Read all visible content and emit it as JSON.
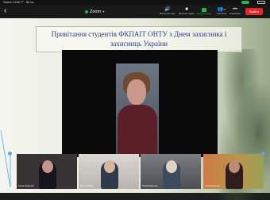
{
  "status_bar": {
    "left": "Search 13:56 77 · 86 ms"
  },
  "toolbar": {
    "back_glyph": "‹",
    "meeting_title": "Zoom",
    "tools": [
      {
        "icon": "speaker-icon",
        "glyph": "🔊",
        "label": "Выключить звук"
      },
      {
        "icon": "camera-icon",
        "glyph": "■",
        "label": "Включить видео"
      },
      {
        "icon": "share-icon",
        "glyph": "",
        "label": "Демонстрация"
      },
      {
        "icon": "participants-icon",
        "glyph": "👥",
        "label": "Участники",
        "count": "27"
      },
      {
        "icon": "more-icon",
        "glyph": "•••",
        "label": "Подробнее"
      }
    ],
    "leave_label": "Выйти"
  },
  "slide": {
    "title": "Привітання студентів ФКПАІТ ОНТУ з Днем захисника і захисниць України"
  },
  "thumbnails": [
    {
      "name": "Олена Ковальова"
    },
    {
      "name": "Ірина Андріїва"
    },
    {
      "name": "Наталія Вергасюк"
    },
    {
      "name": "Тетяна Петренко"
    }
  ],
  "colors": {
    "accent_green": "#2bb24c",
    "leave_red": "#e0282b",
    "title_blue": "#2b3f8e"
  }
}
